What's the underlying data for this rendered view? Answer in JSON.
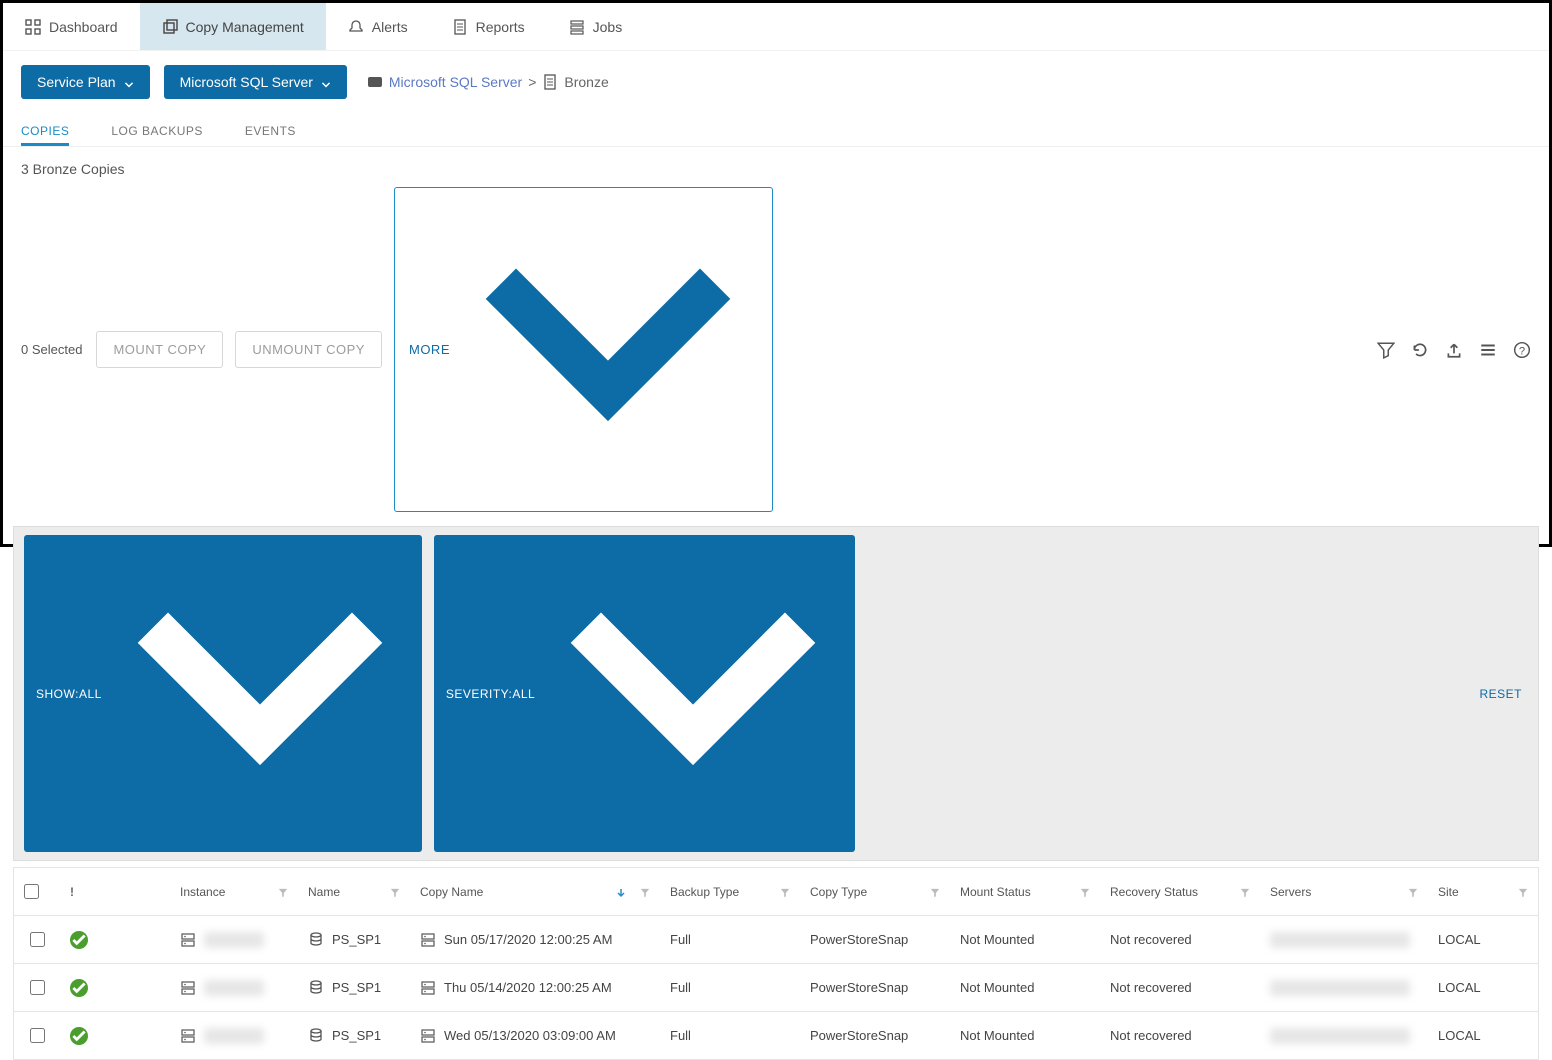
{
  "nav": {
    "dashboard": "Dashboard",
    "copy": "Copy Management",
    "alerts": "Alerts",
    "reports": "Reports",
    "jobs": "Jobs"
  },
  "toolbar": {
    "service_plan": "Service Plan",
    "server": "Microsoft SQL Server"
  },
  "breadcrumb": {
    "link": "Microsoft SQL Server",
    "sep": ">",
    "current": "Bronze"
  },
  "subtabs": {
    "copies": "COPIES",
    "log": "LOG BACKUPS",
    "events": "EVENTS"
  },
  "count_label": "3 Bronze Copies",
  "actions": {
    "selected": "0 Selected",
    "mount": "MOUNT COPY",
    "unmount": "UNMOUNT COPY",
    "more": "MORE"
  },
  "filters": {
    "show": "SHOW:ALL",
    "severity": "SEVERITY:ALL",
    "reset": "RESET"
  },
  "headers": {
    "status": "!",
    "instance": "Instance",
    "name": "Name",
    "copy": "Copy Name",
    "btype": "Backup Type",
    "ctype": "Copy Type",
    "mount": "Mount Status",
    "rec": "Recovery Status",
    "servers": "Servers",
    "site": "Site"
  },
  "rows": [
    {
      "name": "PS_SP1",
      "copy": "Sun 05/17/2020 12:00:25 AM",
      "btype": "Full",
      "ctype": "PowerStoreSnap",
      "mount": "Not Mounted",
      "rec": "Not recovered",
      "site": "LOCAL"
    },
    {
      "name": "PS_SP1",
      "copy": "Thu 05/14/2020 12:00:25 AM",
      "btype": "Full",
      "ctype": "PowerStoreSnap",
      "mount": "Not Mounted",
      "rec": "Not recovered",
      "site": "LOCAL"
    },
    {
      "name": "PS_SP1",
      "copy": "Wed 05/13/2020 03:09:00 AM",
      "btype": "Full",
      "ctype": "PowerStoreSnap",
      "mount": "Not Mounted",
      "rec": "Not recovered",
      "site": "LOCAL"
    }
  ]
}
